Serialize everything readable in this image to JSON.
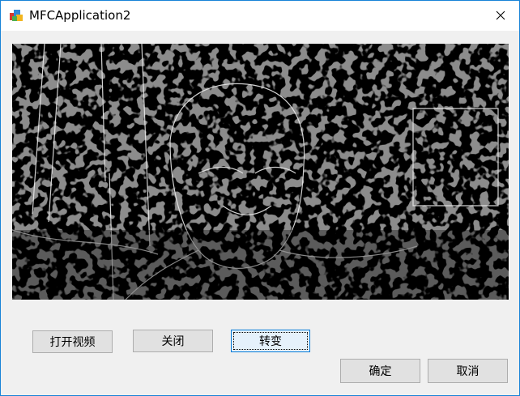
{
  "window": {
    "title": "MFCApplication2"
  },
  "buttons": {
    "open_video": "打开视频",
    "close": "关闭",
    "convert": "转变",
    "ok": "确定",
    "cancel": "取消"
  },
  "colors": {
    "accent": "#0078d7",
    "border": "#1883d7",
    "canvas": "#000000"
  },
  "icons": {
    "app": "mfc-app-icon",
    "close": "close-icon"
  }
}
